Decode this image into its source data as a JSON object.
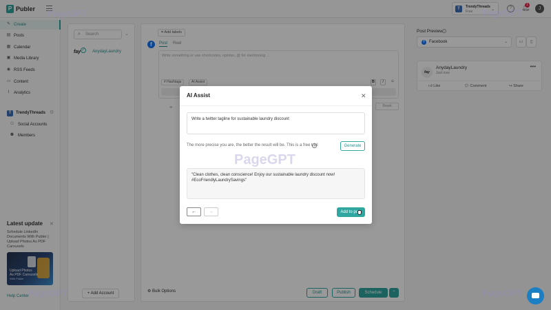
{
  "app": {
    "name": "Publer"
  },
  "topbar": {
    "workspace_initial": "T",
    "workspace_name": "TrendyThreads",
    "plan": "Free",
    "notification_count": "1",
    "user_initial": "J"
  },
  "nav": {
    "items": [
      {
        "icon": "create-icon",
        "label": "Create",
        "active": true
      },
      {
        "icon": "posts-icon",
        "label": "Posts"
      },
      {
        "icon": "calendar-icon",
        "label": "Calendar"
      },
      {
        "icon": "media-library-icon",
        "label": "Media Library"
      },
      {
        "icon": "rss-icon",
        "label": "RSS Feeds"
      },
      {
        "icon": "content-icon",
        "label": "Content"
      },
      {
        "icon": "analytics-icon",
        "label": "Analytics"
      }
    ],
    "workspace": {
      "initial": "T",
      "label": "TrendyThreads"
    },
    "workspace_items": [
      {
        "icon": "social-accounts-icon",
        "label": "Social Accounts"
      },
      {
        "icon": "members-icon",
        "label": "Members"
      }
    ],
    "latest_update": {
      "title": "Latest update",
      "text": "Schedule LinkedIn Documents With Publer | Upload Photos As PDF Carousels",
      "promo_line1": "Upload Photos",
      "promo_line2": "As PDF Carousels",
      "promo_line3": "With Publer"
    },
    "help": "Help Center"
  },
  "accounts": {
    "search_placeholder": "Search",
    "items": [
      {
        "logo": "fay",
        "name": "AnydayLaundry",
        "selected": true
      }
    ],
    "add_button": "Add Account"
  },
  "composer": {
    "add_labels": "Add labels",
    "tabs": [
      {
        "label": "Post",
        "active": true
      },
      {
        "label": "Reel"
      }
    ],
    "placeholder": "Write something or use shortcodes, spintax, @ for mentioning ...",
    "hashtags": "# Hashtags",
    "ai_assist": "AI Assist",
    "bold": "B",
    "italic": "I",
    "reset": "Reset",
    "bulk_options": "Bulk Options",
    "draft": "Draft",
    "publish": "Publish",
    "schedule": "Schedule"
  },
  "preview": {
    "title": "Post Preview",
    "network": "Facebook",
    "card": {
      "avatar_text": "fay",
      "name": "AnydayLaundry",
      "time": "Just now",
      "like": "Like",
      "comment": "Comment",
      "share": "Share"
    }
  },
  "modal": {
    "title": "AI Assist",
    "prompt": "Write a twitter tagline for sustainable laundry discount",
    "hint": "The more precise you are, the better the result will be. This is a free trial",
    "generate": "Generate",
    "result": "\"Clean clothes, clean conscience! Enjoy our sustainable laundry discount now! #EcoFriendlyLaundrySavings\"",
    "prev": "←",
    "next": "→",
    "add_to_post": "Add to post"
  },
  "watermark": "PageGPT",
  "colors": {
    "accent": "#2fa6a0",
    "facebook": "#1877f2",
    "chat": "#1c7fc4",
    "badge": "#e0284f"
  }
}
